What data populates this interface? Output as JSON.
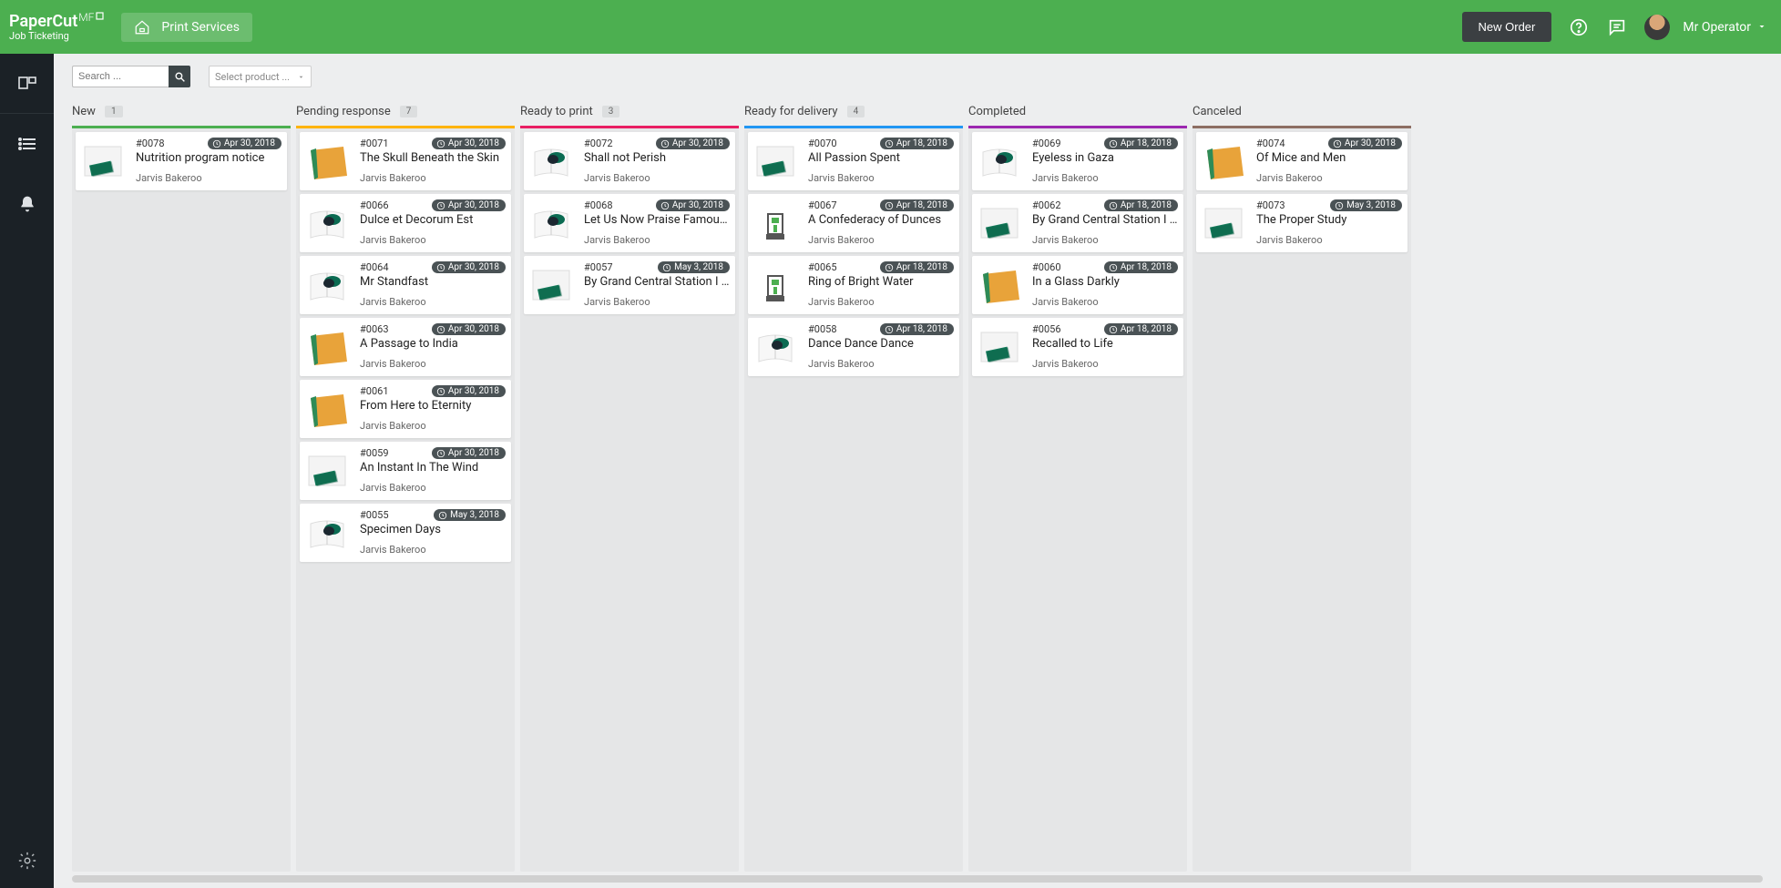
{
  "brand": {
    "main": "PaperCut",
    "suffix": "MF",
    "sub": "Job Ticketing"
  },
  "header": {
    "print_services": "Print Services",
    "new_order": "New Order",
    "user": "Mr Operator"
  },
  "toolbar": {
    "search_placeholder": "Search ...",
    "select_product": "Select product ..."
  },
  "columns": [
    {
      "name": "New",
      "count": "1",
      "color": "#4caf50",
      "cards": [
        {
          "id": "#0078",
          "date": "Apr 30, 2018",
          "title": "Nutrition program notice",
          "user": "Jarvis Bakeroo",
          "thumb": "paper-card"
        }
      ]
    },
    {
      "name": "Pending response",
      "count": "7",
      "color": "#ffb300",
      "cards": [
        {
          "id": "#0071",
          "date": "Apr 30, 2018",
          "title": "The Skull Beneath the Skin",
          "user": "Jarvis Bakeroo",
          "thumb": "folder"
        },
        {
          "id": "#0066",
          "date": "Apr 30, 2018",
          "title": "Dulce et Decorum Est",
          "user": "Jarvis Bakeroo",
          "thumb": "booklet"
        },
        {
          "id": "#0064",
          "date": "Apr 30, 2018",
          "title": "Mr Standfast",
          "user": "Jarvis Bakeroo",
          "thumb": "booklet"
        },
        {
          "id": "#0063",
          "date": "Apr 30, 2018",
          "title": "A Passage to India",
          "user": "Jarvis Bakeroo",
          "thumb": "folder"
        },
        {
          "id": "#0061",
          "date": "Apr 30, 2018",
          "title": "From Here to Eternity",
          "user": "Jarvis Bakeroo",
          "thumb": "folder"
        },
        {
          "id": "#0059",
          "date": "Apr 30, 2018",
          "title": "An Instant In The Wind",
          "user": "Jarvis Bakeroo",
          "thumb": "paper-card"
        },
        {
          "id": "#0055",
          "date": "May 3, 2018",
          "title": "Specimen Days",
          "user": "Jarvis Bakeroo",
          "thumb": "booklet"
        }
      ]
    },
    {
      "name": "Ready to print",
      "count": "3",
      "color": "#e91e63",
      "cards": [
        {
          "id": "#0072",
          "date": "Apr 30, 2018",
          "title": "Shall not Perish",
          "user": "Jarvis Bakeroo",
          "thumb": "booklet"
        },
        {
          "id": "#0068",
          "date": "Apr 30, 2018",
          "title": "Let Us Now Praise Famous ...",
          "user": "Jarvis Bakeroo",
          "thumb": "booklet"
        },
        {
          "id": "#0057",
          "date": "May 3, 2018",
          "title": "By Grand Central Station I S...",
          "user": "Jarvis Bakeroo",
          "thumb": "paper-card"
        }
      ]
    },
    {
      "name": "Ready for delivery",
      "count": "4",
      "color": "#2196f3",
      "cards": [
        {
          "id": "#0070",
          "date": "Apr 18, 2018",
          "title": "All Passion Spent",
          "user": "Jarvis Bakeroo",
          "thumb": "paper-card"
        },
        {
          "id": "#0067",
          "date": "Apr 18, 2018",
          "title": "A Confederacy of Dunces",
          "user": "Jarvis Bakeroo",
          "thumb": "3dprinter"
        },
        {
          "id": "#0065",
          "date": "Apr 18, 2018",
          "title": "Ring of Bright Water",
          "user": "Jarvis Bakeroo",
          "thumb": "3dprinter"
        },
        {
          "id": "#0058",
          "date": "Apr 18, 2018",
          "title": "Dance Dance Dance",
          "user": "Jarvis Bakeroo",
          "thumb": "booklet"
        }
      ]
    },
    {
      "name": "Completed",
      "count": "",
      "color": "#9c27b0",
      "cards": [
        {
          "id": "#0069",
          "date": "Apr 18, 2018",
          "title": "Eyeless in Gaza",
          "user": "Jarvis Bakeroo",
          "thumb": "booklet"
        },
        {
          "id": "#0062",
          "date": "Apr 18, 2018",
          "title": "By Grand Central Station I S...",
          "user": "Jarvis Bakeroo",
          "thumb": "paper-card"
        },
        {
          "id": "#0060",
          "date": "Apr 18, 2018",
          "title": "In a Glass Darkly",
          "user": "Jarvis Bakeroo",
          "thumb": "folder"
        },
        {
          "id": "#0056",
          "date": "Apr 18, 2018",
          "title": "Recalled to Life",
          "user": "Jarvis Bakeroo",
          "thumb": "paper-card"
        }
      ]
    },
    {
      "name": "Canceled",
      "count": "",
      "color": "#8d6e63",
      "cards": [
        {
          "id": "#0074",
          "date": "Apr 30, 2018",
          "title": "Of Mice and Men",
          "user": "Jarvis Bakeroo",
          "thumb": "folder"
        },
        {
          "id": "#0073",
          "date": "May 3, 2018",
          "title": "The Proper Study",
          "user": "Jarvis Bakeroo",
          "thumb": "paper-card"
        }
      ]
    }
  ]
}
